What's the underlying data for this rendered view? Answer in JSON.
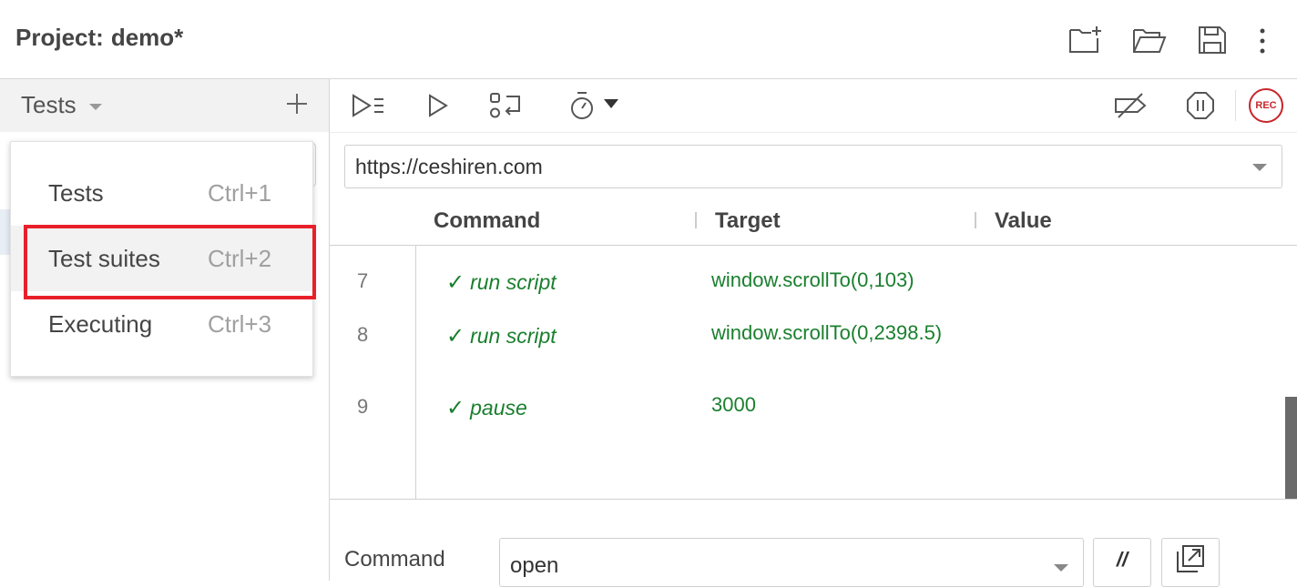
{
  "header": {
    "project_label": "Project:",
    "project_name": "demo*",
    "icons": [
      "new-project-icon",
      "open-folder-icon",
      "save-icon",
      "more-vertical-icon"
    ]
  },
  "sidebar": {
    "selector_label": "Tests",
    "add_icon": "plus-icon"
  },
  "dropdown": {
    "items": [
      {
        "label": "Tests",
        "shortcut": "Ctrl+1"
      },
      {
        "label": "Test suites",
        "shortcut": "Ctrl+2"
      },
      {
        "label": "Executing",
        "shortcut": "Ctrl+3"
      }
    ],
    "highlighted_index": 1
  },
  "toolbar": {
    "left_icons": [
      "run-all-icon",
      "run-current-icon",
      "step-over-icon",
      "speed-icon"
    ],
    "right_icons": [
      "disable-breakpoints-icon",
      "pause-exceptions-icon"
    ],
    "rec_label": "REC"
  },
  "url": {
    "value": "https://ceshiren.com"
  },
  "table": {
    "headers": {
      "command": "Command",
      "target": "Target",
      "value": "Value"
    },
    "rows": [
      {
        "num": "7",
        "command": "run script",
        "target": "window.scrollTo(0,103)",
        "value": ""
      },
      {
        "num": "8",
        "command": "run script",
        "target": "window.scrollTo(0,2398.5)",
        "value": ""
      },
      {
        "num": "9",
        "command": "pause",
        "target": "3000",
        "value": ""
      }
    ],
    "check_glyph": "✓"
  },
  "editor": {
    "command_label": "Command",
    "command_value": "open",
    "comment_button": "//"
  },
  "colors": {
    "success_green": "#1a7f2e",
    "rec_red": "#c9252c",
    "highlight_border": "#e8202a"
  }
}
